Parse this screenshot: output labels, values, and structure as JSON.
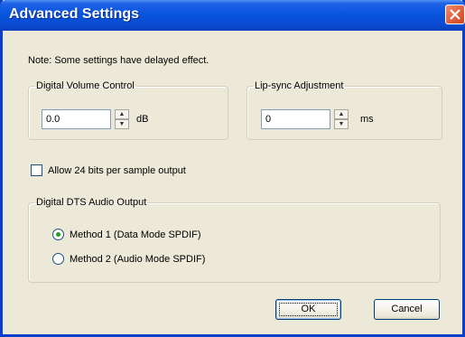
{
  "dialog": {
    "title": "Advanced Settings",
    "close_icon": "close-icon",
    "note": "Note: Some settings have delayed effect."
  },
  "volume": {
    "legend": "Digital Volume Control",
    "value": "0.0",
    "unit": "dB"
  },
  "lipsync": {
    "legend": "Lip-sync Adjustment",
    "value": "0",
    "unit": "ms"
  },
  "allow24": {
    "label": "Allow 24 bits per sample output",
    "checked": false
  },
  "dts": {
    "legend": "Digital DTS Audio Output",
    "options": [
      {
        "label": "Method 1 (Data Mode SPDIF)",
        "selected": true
      },
      {
        "label": "Method 2 (Audio Mode SPDIF)",
        "selected": false
      }
    ]
  },
  "buttons": {
    "ok": "OK",
    "cancel": "Cancel"
  },
  "colors": {
    "titlebar": "#0855dd",
    "dialog_bg": "#ece9d8",
    "radio_dot": "#21a121"
  }
}
